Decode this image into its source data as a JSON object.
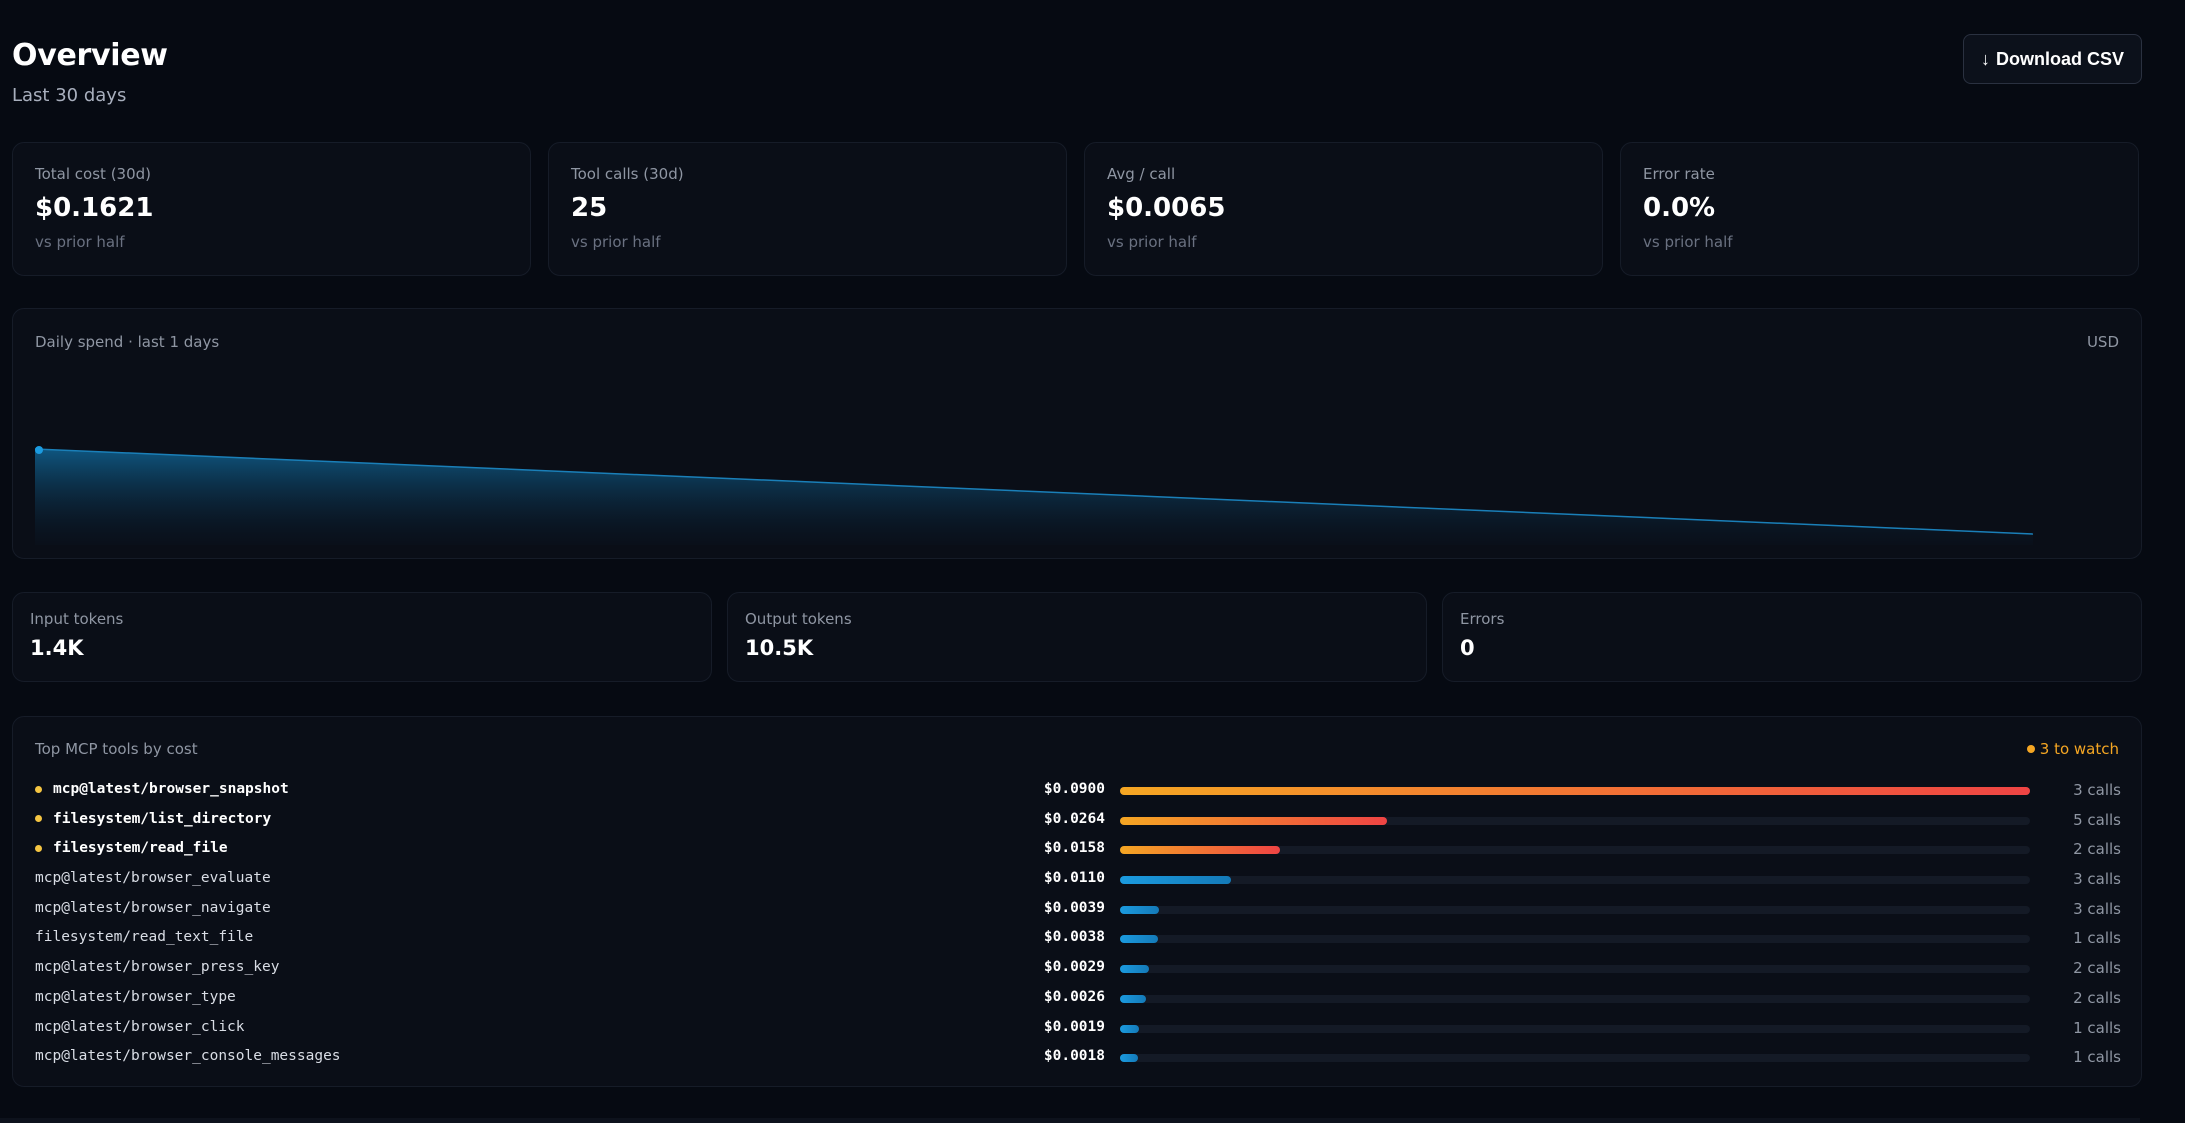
{
  "header": {
    "title": "Overview",
    "subtitle": "Last 30 days",
    "download_label": "Download CSV",
    "download_icon": "arrow-down-icon"
  },
  "kpis": [
    {
      "label": "Total cost (30d)",
      "value": "$0.1621",
      "sub": "vs prior half"
    },
    {
      "label": "Tool calls (30d)",
      "value": "25",
      "sub": "vs prior half"
    },
    {
      "label": "Avg / call",
      "value": "$0.0065",
      "sub": "vs prior half"
    },
    {
      "label": "Error rate",
      "value": "0.0%",
      "sub": "vs prior half"
    }
  ],
  "daily_chart": {
    "title": "Daily spend · last 1 days",
    "unit": "USD",
    "color": "#1b9be0"
  },
  "mini_stats": [
    {
      "label": "Input tokens",
      "value": "1.4K"
    },
    {
      "label": "Output tokens",
      "value": "10.5K"
    },
    {
      "label": "Errors",
      "value": "0"
    }
  ],
  "tools": {
    "title": "Top MCP tools by cost",
    "watch_label": "3 to watch",
    "warn_color": "#f5a623",
    "normal_color": "#1b9be0",
    "rows": [
      {
        "name": "mcp@latest/browser_snapshot",
        "cost": "$0.0900",
        "value": 0.09,
        "calls": "3 calls",
        "hot": true
      },
      {
        "name": "filesystem/list_directory",
        "cost": "$0.0264",
        "value": 0.0264,
        "calls": "5 calls",
        "hot": true
      },
      {
        "name": "filesystem/read_file",
        "cost": "$0.0158",
        "value": 0.0158,
        "calls": "2 calls",
        "hot": true
      },
      {
        "name": "mcp@latest/browser_evaluate",
        "cost": "$0.0110",
        "value": 0.011,
        "calls": "3 calls",
        "hot": false
      },
      {
        "name": "mcp@latest/browser_navigate",
        "cost": "$0.0039",
        "value": 0.0039,
        "calls": "3 calls",
        "hot": false
      },
      {
        "name": "filesystem/read_text_file",
        "cost": "$0.0038",
        "value": 0.0038,
        "calls": "1 calls",
        "hot": false
      },
      {
        "name": "mcp@latest/browser_press_key",
        "cost": "$0.0029",
        "value": 0.0029,
        "calls": "2 calls",
        "hot": false
      },
      {
        "name": "mcp@latest/browser_type",
        "cost": "$0.0026",
        "value": 0.0026,
        "calls": "2 calls",
        "hot": false
      },
      {
        "name": "mcp@latest/browser_click",
        "cost": "$0.0019",
        "value": 0.0019,
        "calls": "1 calls",
        "hot": false
      },
      {
        "name": "mcp@latest/browser_console_messages",
        "cost": "$0.0018",
        "value": 0.0018,
        "calls": "1 calls",
        "hot": false
      }
    ]
  }
}
